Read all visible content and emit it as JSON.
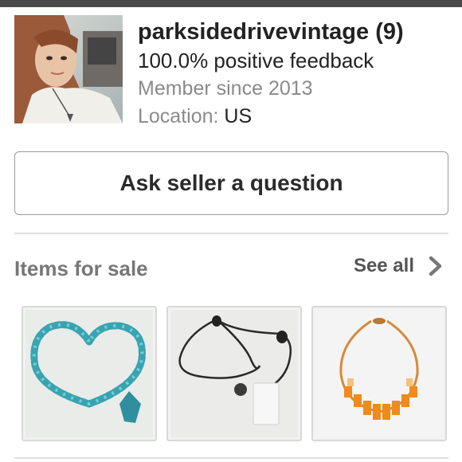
{
  "seller": {
    "name": "parksidedrivevintage",
    "score": "(9)",
    "feedback": "100.0% positive feedback",
    "member_since": "Member since 2013",
    "location_label": "Location:",
    "location_value": "US"
  },
  "actions": {
    "ask_question": "Ask seller a question"
  },
  "items_section": {
    "title": "Items for sale",
    "see_all": "See all",
    "items": [
      {
        "icon": "turquoise-heart-necklace"
      },
      {
        "icon": "black-beaded-necklace"
      },
      {
        "icon": "orange-bib-necklace"
      }
    ]
  },
  "colors": {
    "topbar": "#4a4a4a",
    "muted_text": "#8a8a8a",
    "button_border": "#9a9a9a"
  }
}
